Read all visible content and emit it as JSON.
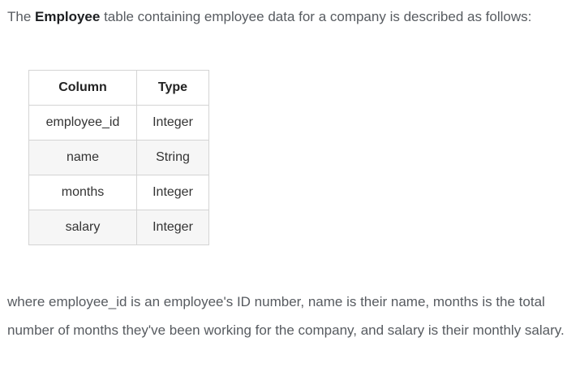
{
  "intro": {
    "prefix": "The ",
    "table_name": "Employee",
    "suffix": " table containing employee data for a company is described as follows:"
  },
  "schema": {
    "headers": [
      "Column",
      "Type"
    ],
    "rows": [
      {
        "column": "employee_id",
        "type": "Integer"
      },
      {
        "column": "name",
        "type": "String"
      },
      {
        "column": "months",
        "type": "Integer"
      },
      {
        "column": "salary",
        "type": "Integer"
      }
    ]
  },
  "outro": {
    "text": "where employee_id is an employee's ID number, name is their name, months is the total number of months they've been working for the company, and salary is their monthly salary."
  }
}
